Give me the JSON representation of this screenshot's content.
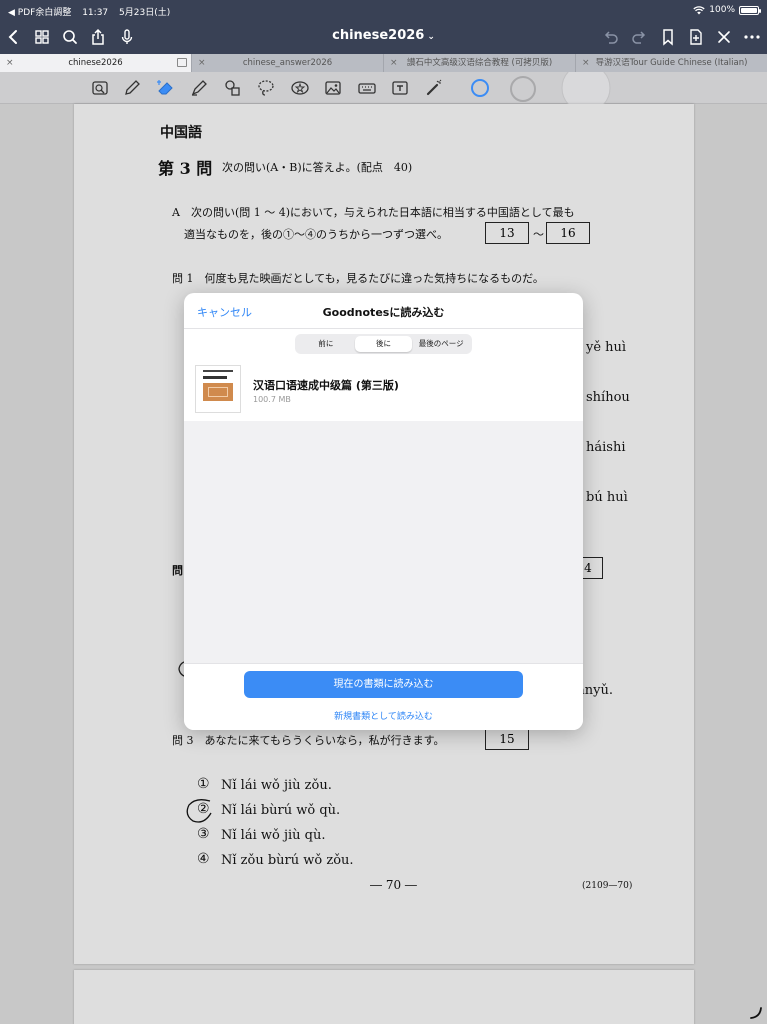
{
  "status_bar": {
    "back_app": "◀ PDF余白調整",
    "time": "11:37",
    "date": "5月23日(土)",
    "battery": "100%"
  },
  "toolbar": {
    "title": "chinese2026",
    "title_chevron": "⌄"
  },
  "tabs": [
    {
      "label": "chinese2026",
      "active": true
    },
    {
      "label": "chinese_answer2026",
      "active": false
    },
    {
      "label": "讃石中文高级汉语综合教程 (可拷贝版)",
      "active": false
    },
    {
      "label": "导游汉语Tour Guide Chinese (Italian)",
      "active": false
    }
  ],
  "document": {
    "subject": "中国語",
    "question_no": "第 3 問",
    "question_instruction": "次の問い(A・B)に答えよ。(配点　40)",
    "part_a_line1": "A　次の問い(問 1 ～ 4)において，与えられた日本語に相当する中国語として最も",
    "part_a_line2": "適当なものを，後の①～④のうちから一つずつ選べ。",
    "box_13": "13",
    "tilde": "～",
    "box_16": "16",
    "q1": "問 1　何度も見た映画だとしても，見るたびに違った気持ちになるものだ。",
    "right_frag_1": "yě huì",
    "right_frag_2": "shíhou",
    "right_frag_3": "háishi",
    "right_frag_4": "bú huì",
    "left_frag_q2": "問",
    "right_frag_box": "4",
    "right_frag_5": "ànyǔ.",
    "q3": "問 3　あなたに来てもらうくらいなら，私が行きます。",
    "box_15": "15",
    "opt1_no": "①",
    "opt1": "Nǐ lái wǒ jiù zǒu.",
    "opt2_no": "②",
    "opt2": "Nǐ lái bùrú wǒ qù.",
    "opt3_no": "③",
    "opt3": "Nǐ lái wǒ jiù qù.",
    "opt4_no": "④",
    "opt4": "Nǐ zǒu bùrú wǒ zǒu.",
    "page_no": "― 70 ―",
    "page_code": "(2109—70)"
  },
  "modal": {
    "cancel": "キャンセル",
    "title": "Goodnotesに読み込む",
    "segments": [
      "前に",
      "後に",
      "最後のページ"
    ],
    "selected_segment": "後に",
    "item_title": "汉语口语速成中级篇 (第三版)",
    "item_size": "100.7 MB",
    "import_current": "現在の書類に読み込む",
    "import_new": "新規書類として読み込む"
  },
  "colors": {
    "topbar": "#394155",
    "accent": "#3b8cf5",
    "link": "#2f86f6"
  }
}
